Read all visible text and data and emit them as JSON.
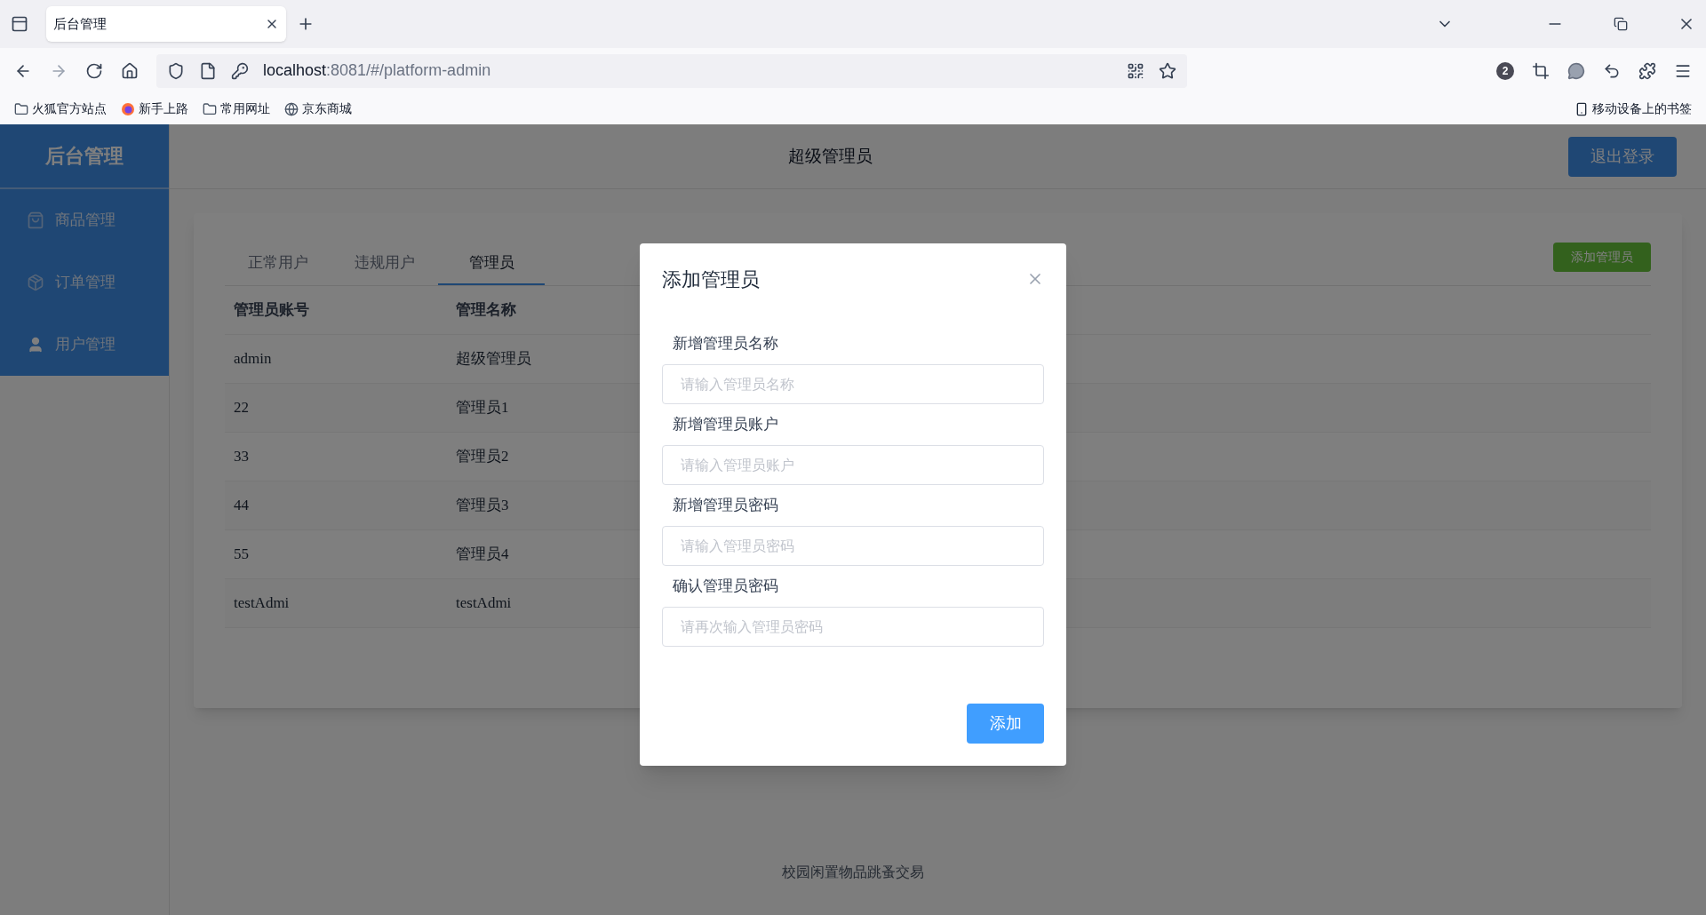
{
  "browser": {
    "tabs": [
      {
        "title": "后台管理",
        "selected": true
      }
    ],
    "address": {
      "host": "localhost",
      "rest": ":8081/#/platform-admin"
    },
    "notification_count": "2",
    "bookmarks": [
      {
        "label": "火狐官方站点",
        "kind": "folder"
      },
      {
        "label": "新手上路",
        "kind": "firefox"
      },
      {
        "label": "常用网址",
        "kind": "folder"
      },
      {
        "label": "京东商城",
        "kind": "globe"
      }
    ],
    "mobile_bookmarks": "移动设备上的书签"
  },
  "app": {
    "brand": "后台管理",
    "header_title": "超级管理员",
    "logout": "退出登录",
    "sidebar": [
      {
        "label": "商品管理",
        "kind": "bag"
      },
      {
        "label": "订单管理",
        "kind": "order"
      },
      {
        "label": "用户管理",
        "kind": "user"
      }
    ],
    "tabs": [
      {
        "label": "正常用户",
        "selected": false
      },
      {
        "label": "违规用户",
        "selected": false
      },
      {
        "label": "管理员",
        "selected": true
      }
    ],
    "add_button": "添加管理员",
    "table": {
      "columns": [
        "管理员账号",
        "管理名称"
      ],
      "rows": [
        [
          "admin",
          "超级管理员"
        ],
        [
          "22",
          "管理员1"
        ],
        [
          "33",
          "管理员2"
        ],
        [
          "44",
          "管理员3"
        ],
        [
          "55",
          "管理员4"
        ],
        [
          "testAdmi",
          "testAdmi"
        ]
      ]
    },
    "footer": "校园闲置物品跳蚤交易"
  },
  "modal": {
    "title": "添加管理员",
    "fields": [
      {
        "label": "新增管理员名称",
        "placeholder": "请输入管理员名称"
      },
      {
        "label": "新增管理员账户",
        "placeholder": "请输入管理员账户"
      },
      {
        "label": "新增管理员密码",
        "placeholder": "请输入管理员密码"
      },
      {
        "label": "确认管理员密码",
        "placeholder": "请再次输入管理员密码"
      }
    ],
    "submit": "添加"
  }
}
